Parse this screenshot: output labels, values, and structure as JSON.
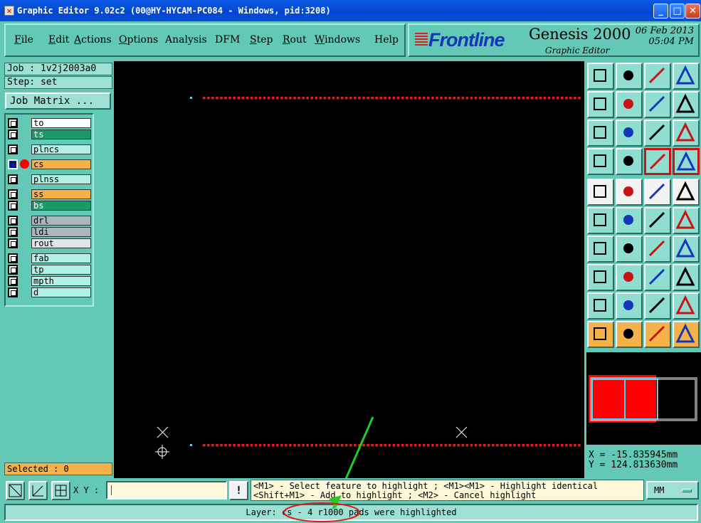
{
  "window": {
    "title": "Graphic Editor 9.02c2 (00@HY-HYCAM-PC084 - Windows, pid:3208)"
  },
  "menu": [
    {
      "label": "File",
      "u": "F"
    },
    {
      "label": "Edit",
      "u": "E"
    },
    {
      "label": "Actions",
      "u": "A"
    },
    {
      "label": "Options",
      "u": "O"
    },
    {
      "label": "Analysis",
      "u": ""
    },
    {
      "label": "DFM",
      "u": ""
    },
    {
      "label": "Step",
      "u": "S"
    },
    {
      "label": "Rout",
      "u": "R"
    },
    {
      "label": "Windows",
      "u": "W"
    },
    {
      "label": "Help",
      "u": ""
    }
  ],
  "brand": {
    "logo": "Frontline",
    "product": "Genesis 2000",
    "subtitle": "Graphic Editor",
    "date": "06 Feb 2013",
    "time": "05:04 PM"
  },
  "job": {
    "job_label": "Job : 1v2j2003a0",
    "step_label": "Step: set",
    "matrix_button": "Job Matrix ..."
  },
  "layers": [
    {
      "name": "to",
      "color": "#ffffff",
      "display": false,
      "work": false
    },
    {
      "name": "ts",
      "color": "#1a9a6a",
      "display": false,
      "work": false
    },
    {
      "name": "plncs",
      "color": "#b5f0e6",
      "display": false,
      "work": false
    },
    {
      "name": "cs",
      "color": "#f5b24a",
      "display": true,
      "work": true
    },
    {
      "name": "plnss",
      "color": "#b5f0e6",
      "display": false,
      "work": false
    },
    {
      "name": "ss",
      "color": "#f5b24a",
      "display": false,
      "work": false
    },
    {
      "name": "bs",
      "color": "#1a9a6a",
      "display": false,
      "work": false
    },
    {
      "name": "drl",
      "color": "#a9b7bd",
      "display": false,
      "work": false
    },
    {
      "name": "ldi",
      "color": "#a9b7bd",
      "display": false,
      "work": false
    },
    {
      "name": "rout",
      "color": "#dfe7e6",
      "display": false,
      "work": false
    },
    {
      "name": "fab",
      "color": "#b5f0e6",
      "display": false,
      "work": false
    },
    {
      "name": "tp",
      "color": "#b5f0e6",
      "display": false,
      "work": false
    },
    {
      "name": "mpth",
      "color": "#b5f0e6",
      "display": false,
      "work": false
    },
    {
      "name": "d",
      "color": "#b5f0e6",
      "display": false,
      "work": false
    }
  ],
  "tools": {
    "view": [
      "zoom-home-icon",
      "zoom-out-icon",
      "home-view-icon",
      "window-tile-icon",
      "pan-left-icon",
      "pan-right-icon",
      "redraw-icon",
      "snap-icon",
      "fit-all-icon",
      "fit-profile-icon",
      "scale-one-to-one-icon",
      "help-question-icon",
      "measure-tool-icon",
      "grid-icon",
      "highlight-layers-icon",
      "highlight-select-icon"
    ],
    "edit": [
      "add-pad-icon",
      "add-surface-icon",
      "ruler-icon",
      "donut-pad-icon",
      "connect-nodes-icon",
      "delete-node-icon",
      "add-line-icon",
      "add-line-end-icon",
      "angle-line-icon",
      "diagonal-line-icon",
      "arc-tool-icon",
      "text-tool-icon",
      "pad-select-icon",
      "line-break-icon",
      "move-pad-icon",
      "copy-pads-icon",
      "triangle-edit-icon",
      "triangle-up-icon",
      "triangle-move-icon",
      "triangle-cross-icon",
      "pointer-icon",
      "select-box-icon",
      "select-circle-icon",
      "select-net-icon"
    ]
  },
  "coords": {
    "x": "X = -15.835945mm",
    "y": "Y = 124.813630mm"
  },
  "selected": "Selected : 0",
  "xy_label": "X Y :",
  "xy_value": "",
  "info_button": "!",
  "hint": {
    "line1": "<M1> - Select feature to highlight ; <M1><M1> - Highlight identical",
    "line2": "<Shift+M1> - Add to highlight ; <M2> - Cancel highlight"
  },
  "units": "MM",
  "status": "Layer: cs - 4 r1000 pads were highlighted",
  "colors": {
    "canvas": "#000000",
    "pad": "#e02020",
    "highlight": "#ff0000",
    "arrow": "#22cc22",
    "accent": "#63c9b6"
  }
}
